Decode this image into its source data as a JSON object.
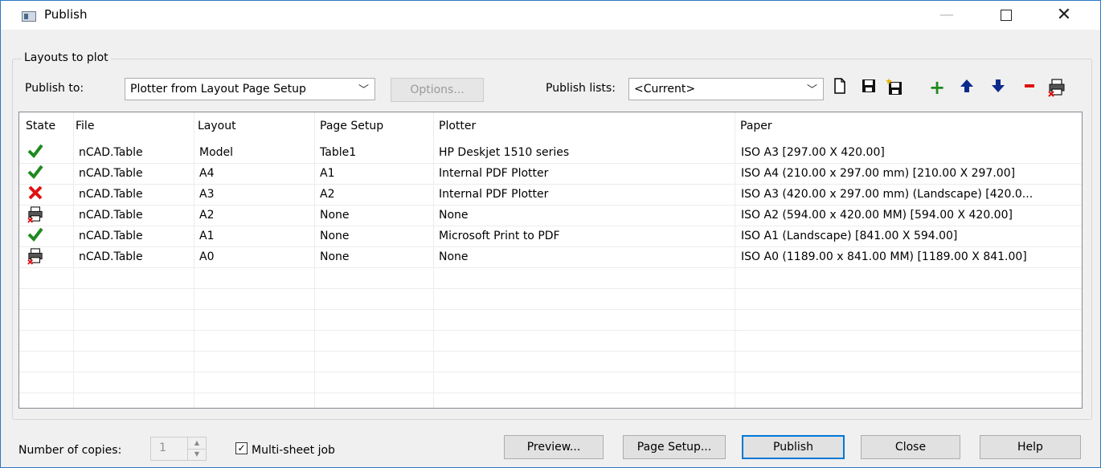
{
  "window": {
    "title": "Publish"
  },
  "group_label": "Layouts to plot",
  "publish_to": {
    "label": "Publish to:",
    "value": "Plotter from Layout Page Setup",
    "options_button": "Options..."
  },
  "publish_lists": {
    "label": "Publish lists:",
    "value": "<Current>"
  },
  "toolbar_icons": [
    "new-list-icon",
    "save-list-icon",
    "save-as-list-icon",
    "add-icon",
    "move-up-icon",
    "move-down-icon",
    "remove-icon",
    "plot-status-icon"
  ],
  "table": {
    "headers": [
      "State",
      "File",
      "Layout",
      "Page Setup",
      "Plotter",
      "Paper"
    ],
    "rows": [
      {
        "state": "ok",
        "file": "nCAD.Table",
        "layout": "Model",
        "page_setup": "Table1",
        "plotter": "HP Deskjet 1510 series",
        "paper": "ISO A3 [297.00 X 420.00]"
      },
      {
        "state": "ok",
        "file": "nCAD.Table",
        "layout": "A4",
        "page_setup": "A1",
        "plotter": "Internal PDF Plotter",
        "paper": "ISO A4 (210.00 x 297.00 mm) [210.00 X 297.00]"
      },
      {
        "state": "error",
        "file": "nCAD.Table",
        "layout": "A3",
        "page_setup": "A2",
        "plotter": "Internal PDF Plotter",
        "paper": "ISO A3 (420.00 x 297.00 mm) (Landscape) [420.0..."
      },
      {
        "state": "no-plotter",
        "file": "nCAD.Table",
        "layout": "A2",
        "page_setup": "None",
        "plotter": "None",
        "paper": "ISO A2 (594.00 x 420.00 MM) [594.00 X 420.00]"
      },
      {
        "state": "ok",
        "file": "nCAD.Table",
        "layout": "A1",
        "page_setup": "None",
        "plotter": "Microsoft Print to PDF",
        "paper": "ISO A1 (Landscape) [841.00 X 594.00]"
      },
      {
        "state": "no-plotter",
        "file": "nCAD.Table",
        "layout": "A0",
        "page_setup": "None",
        "plotter": "None",
        "paper": "ISO A0 (1189.00 x 841.00 MM) [1189.00 X 841.00]"
      }
    ]
  },
  "footer": {
    "copies_label": "Number of copies:",
    "copies_value": "1",
    "multisheet_label": "Multi-sheet job",
    "multisheet_checked": true,
    "buttons": {
      "preview": "Preview...",
      "page_setup": "Page Setup...",
      "publish": "Publish",
      "close": "Close",
      "help": "Help"
    }
  },
  "colors": {
    "accent": "#0078d7",
    "ok": "#1e8a1e",
    "error": "#e01010",
    "add": "#1e8a1e",
    "arrow": "#0b2a8c",
    "remove": "#e01010"
  }
}
